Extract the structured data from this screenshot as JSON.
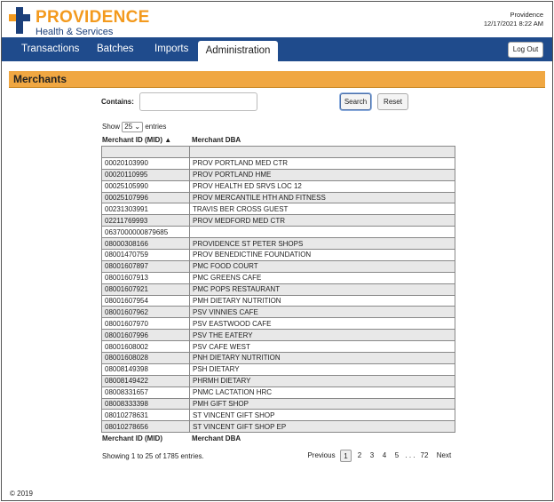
{
  "header": {
    "brand_main": "PROVIDENCE",
    "brand_sub": "Health & Services",
    "user": "Providence",
    "datetime": "12/17/2021 8:22 AM"
  },
  "nav": {
    "tabs": [
      "Transactions",
      "Batches",
      "Imports",
      "Administration"
    ],
    "active": "Administration",
    "logout": "Log Out"
  },
  "section": {
    "title": "Merchants"
  },
  "search": {
    "contains_label": "Contains:",
    "value": "",
    "search_label": "Search",
    "reset_label": "Reset"
  },
  "entries": {
    "show": "Show",
    "value": "25",
    "suffix": "entries"
  },
  "table": {
    "headers": [
      "Merchant ID (MID) ▲",
      "Merchant DBA"
    ],
    "footers": [
      "Merchant ID (MID)",
      "Merchant DBA"
    ],
    "rows": [
      [
        "",
        ""
      ],
      [
        "00020103990",
        "PROV PORTLAND MED CTR"
      ],
      [
        "00020110995",
        "PROV PORTLAND HME"
      ],
      [
        "00025105990",
        "PROV HEALTH ED SRVS LOC 12"
      ],
      [
        "00025107996",
        "PROV MERCANTILE HTH AND FITNESS"
      ],
      [
        "00231303991",
        "TRAVIS BER CROSS GUEST"
      ],
      [
        "02211769993",
        "PROV MEDFORD MED CTR"
      ],
      [
        "0637000000879685",
        ""
      ],
      [
        "08000308166",
        "PROVIDENCE ST PETER SHOPS"
      ],
      [
        "08001470759",
        "PROV BENEDICTINE FOUNDATION"
      ],
      [
        "08001607897",
        "PMC FOOD COURT"
      ],
      [
        "08001607913",
        "PMC GREENS CAFE"
      ],
      [
        "08001607921",
        "PMC POPS RESTAURANT"
      ],
      [
        "08001607954",
        "PMH DIETARY NUTRITION"
      ],
      [
        "08001607962",
        "PSV VINNIES CAFE"
      ],
      [
        "08001607970",
        "PSV EASTWOOD CAFE"
      ],
      [
        "08001607996",
        "PSV THE EATERY"
      ],
      [
        "08001608002",
        "PSV CAFE WEST"
      ],
      [
        "08001608028",
        "PNH DIETARY NUTRITION"
      ],
      [
        "08008149398",
        "PSH DIETARY"
      ],
      [
        "08008149422",
        "PHRMH DIETARY"
      ],
      [
        "08008331657",
        "PNMC LACTATION HRC"
      ],
      [
        "08008333398",
        "PMH GIFT SHOP"
      ],
      [
        "08010278631",
        "ST VINCENT GIFT SHOP"
      ],
      [
        "08010278656",
        "ST VINCENT GIFT SHOP EP"
      ]
    ]
  },
  "pagination": {
    "info": "Showing 1 to 25 of 1785 entries.",
    "previous": "Previous",
    "pages": [
      "1",
      "2",
      "3",
      "4",
      "5"
    ],
    "ellipsis": ". . .",
    "last": "72",
    "next": "Next"
  },
  "footer": {
    "copyright": "© 2019"
  }
}
